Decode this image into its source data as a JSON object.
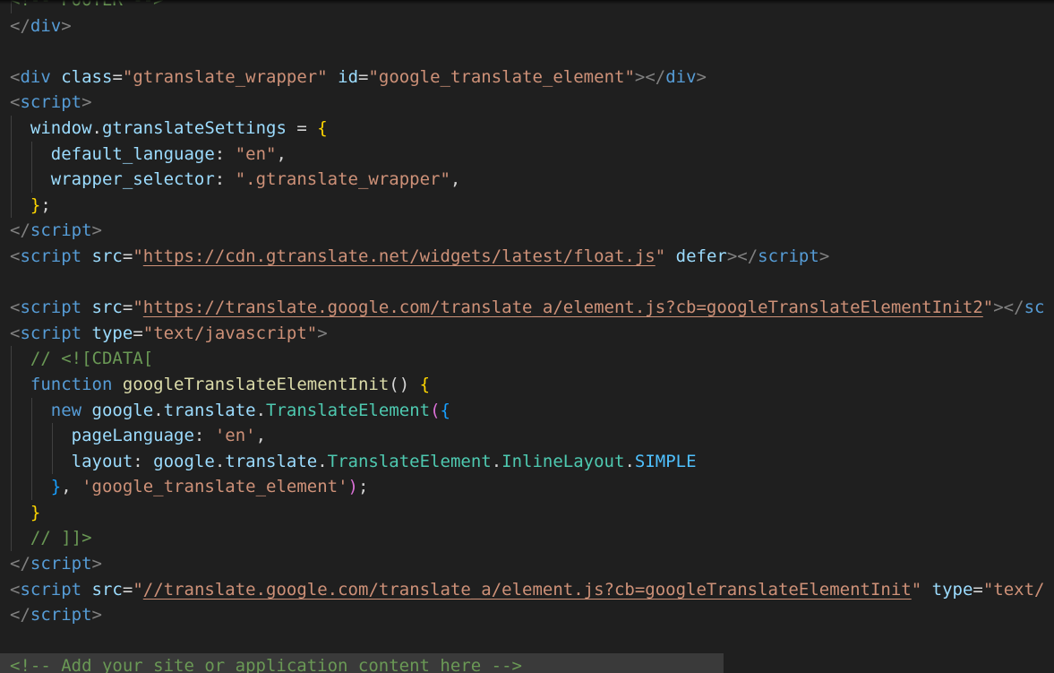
{
  "colors": {
    "background": "#1f1f1f",
    "tag": "#569cd6",
    "attribute": "#9cdcfe",
    "string": "#ce9178",
    "punctuation": "#808080",
    "function": "#dcdcaa",
    "class": "#4ec9b0",
    "comment": "#6a9955",
    "bracket_yellow": "#ffd700",
    "bracket_pink": "#da70d6",
    "bracket_blue": "#179fff"
  },
  "lines": [
    {
      "guides": 1,
      "highlight": false,
      "tokens": [
        {
          "t": "<!-- FOOTER -->",
          "c": "comment"
        }
      ]
    },
    {
      "guides": 0,
      "highlight": false,
      "tokens": [
        {
          "t": "</",
          "c": "punc"
        },
        {
          "t": "div",
          "c": "tag"
        },
        {
          "t": ">",
          "c": "punc"
        }
      ]
    },
    {
      "guides": 0,
      "highlight": false,
      "tokens": []
    },
    {
      "guides": 0,
      "highlight": false,
      "tokens": [
        {
          "t": "<",
          "c": "punc"
        },
        {
          "t": "div",
          "c": "tag"
        },
        {
          "t": " ",
          "c": "plain"
        },
        {
          "t": "class",
          "c": "attr"
        },
        {
          "t": "=",
          "c": "plain"
        },
        {
          "t": "\"gtranslate_wrapper\"",
          "c": "str"
        },
        {
          "t": " ",
          "c": "plain"
        },
        {
          "t": "id",
          "c": "attr"
        },
        {
          "t": "=",
          "c": "plain"
        },
        {
          "t": "\"google_translate_element\"",
          "c": "str"
        },
        {
          "t": "></",
          "c": "punc"
        },
        {
          "t": "div",
          "c": "tag"
        },
        {
          "t": ">",
          "c": "punc"
        }
      ]
    },
    {
      "guides": 0,
      "highlight": false,
      "tokens": [
        {
          "t": "<",
          "c": "punc"
        },
        {
          "t": "script",
          "c": "tag"
        },
        {
          "t": ">",
          "c": "punc"
        }
      ]
    },
    {
      "guides": 1,
      "highlight": false,
      "tokens": [
        {
          "t": "  ",
          "c": "plain"
        },
        {
          "t": "window",
          "c": "var"
        },
        {
          "t": ".",
          "c": "plain"
        },
        {
          "t": "gtranslateSettings",
          "c": "var"
        },
        {
          "t": " = ",
          "c": "plain"
        },
        {
          "t": "{",
          "c": "brace1"
        }
      ]
    },
    {
      "guides": 2,
      "highlight": false,
      "tokens": [
        {
          "t": "    ",
          "c": "plain"
        },
        {
          "t": "default_language",
          "c": "var"
        },
        {
          "t": ": ",
          "c": "plain"
        },
        {
          "t": "\"en\"",
          "c": "str"
        },
        {
          "t": ",",
          "c": "plain"
        }
      ]
    },
    {
      "guides": 2,
      "highlight": false,
      "tokens": [
        {
          "t": "    ",
          "c": "plain"
        },
        {
          "t": "wrapper_selector",
          "c": "var"
        },
        {
          "t": ": ",
          "c": "plain"
        },
        {
          "t": "\".gtranslate_wrapper\"",
          "c": "str"
        },
        {
          "t": ",",
          "c": "plain"
        }
      ]
    },
    {
      "guides": 1,
      "highlight": false,
      "tokens": [
        {
          "t": "  ",
          "c": "plain"
        },
        {
          "t": "}",
          "c": "brace1"
        },
        {
          "t": ";",
          "c": "plain"
        }
      ]
    },
    {
      "guides": 0,
      "highlight": false,
      "tokens": [
        {
          "t": "</",
          "c": "punc"
        },
        {
          "t": "script",
          "c": "tag"
        },
        {
          "t": ">",
          "c": "punc"
        }
      ]
    },
    {
      "guides": 0,
      "highlight": false,
      "tokens": [
        {
          "t": "<",
          "c": "punc"
        },
        {
          "t": "script",
          "c": "tag"
        },
        {
          "t": " ",
          "c": "plain"
        },
        {
          "t": "src",
          "c": "attr"
        },
        {
          "t": "=",
          "c": "plain"
        },
        {
          "t": "\"",
          "c": "str"
        },
        {
          "t": "https://cdn.gtranslate.net/widgets/latest/float.js",
          "c": "url"
        },
        {
          "t": "\"",
          "c": "str"
        },
        {
          "t": " ",
          "c": "plain"
        },
        {
          "t": "defer",
          "c": "attr"
        },
        {
          "t": "></",
          "c": "punc"
        },
        {
          "t": "script",
          "c": "tag"
        },
        {
          "t": ">",
          "c": "punc"
        }
      ]
    },
    {
      "guides": 0,
      "highlight": false,
      "tokens": []
    },
    {
      "guides": 0,
      "highlight": false,
      "tokens": [
        {
          "t": "<",
          "c": "punc"
        },
        {
          "t": "script",
          "c": "tag"
        },
        {
          "t": " ",
          "c": "plain"
        },
        {
          "t": "src",
          "c": "attr"
        },
        {
          "t": "=",
          "c": "plain"
        },
        {
          "t": "\"",
          "c": "str"
        },
        {
          "t": "https://translate.google.com/translate_a/element.js?cb=googleTranslateElementInit2",
          "c": "url"
        },
        {
          "t": "\"",
          "c": "str"
        },
        {
          "t": "></",
          "c": "punc"
        },
        {
          "t": "sc",
          "c": "tag"
        }
      ]
    },
    {
      "guides": 0,
      "highlight": false,
      "tokens": [
        {
          "t": "<",
          "c": "punc"
        },
        {
          "t": "script",
          "c": "tag"
        },
        {
          "t": " ",
          "c": "plain"
        },
        {
          "t": "type",
          "c": "attr"
        },
        {
          "t": "=",
          "c": "plain"
        },
        {
          "t": "\"text/javascript\"",
          "c": "str"
        },
        {
          "t": ">",
          "c": "punc"
        }
      ]
    },
    {
      "guides": 1,
      "highlight": false,
      "tokens": [
        {
          "t": "  ",
          "c": "plain"
        },
        {
          "t": "// <![CDATA[",
          "c": "comment"
        }
      ]
    },
    {
      "guides": 1,
      "highlight": false,
      "tokens": [
        {
          "t": "  ",
          "c": "plain"
        },
        {
          "t": "function",
          "c": "kw"
        },
        {
          "t": " ",
          "c": "plain"
        },
        {
          "t": "googleTranslateElementInit",
          "c": "func"
        },
        {
          "t": "() ",
          "c": "plain"
        },
        {
          "t": "{",
          "c": "brace1"
        }
      ]
    },
    {
      "guides": 2,
      "highlight": false,
      "tokens": [
        {
          "t": "    ",
          "c": "plain"
        },
        {
          "t": "new",
          "c": "kw"
        },
        {
          "t": " ",
          "c": "plain"
        },
        {
          "t": "google",
          "c": "var"
        },
        {
          "t": ".",
          "c": "plain"
        },
        {
          "t": "translate",
          "c": "var"
        },
        {
          "t": ".",
          "c": "plain"
        },
        {
          "t": "TranslateElement",
          "c": "class"
        },
        {
          "t": "(",
          "c": "brace2"
        },
        {
          "t": "{",
          "c": "brace3"
        }
      ]
    },
    {
      "guides": 3,
      "highlight": false,
      "tokens": [
        {
          "t": "      ",
          "c": "plain"
        },
        {
          "t": "pageLanguage",
          "c": "var"
        },
        {
          "t": ": ",
          "c": "plain"
        },
        {
          "t": "'en'",
          "c": "str"
        },
        {
          "t": ",",
          "c": "plain"
        }
      ]
    },
    {
      "guides": 3,
      "highlight": false,
      "tokens": [
        {
          "t": "      ",
          "c": "plain"
        },
        {
          "t": "layout",
          "c": "var"
        },
        {
          "t": ": ",
          "c": "plain"
        },
        {
          "t": "google",
          "c": "var"
        },
        {
          "t": ".",
          "c": "plain"
        },
        {
          "t": "translate",
          "c": "var"
        },
        {
          "t": ".",
          "c": "plain"
        },
        {
          "t": "TranslateElement",
          "c": "class"
        },
        {
          "t": ".",
          "c": "plain"
        },
        {
          "t": "InlineLayout",
          "c": "class"
        },
        {
          "t": ".",
          "c": "plain"
        },
        {
          "t": "SIMPLE",
          "c": "const"
        }
      ]
    },
    {
      "guides": 2,
      "highlight": false,
      "tokens": [
        {
          "t": "    ",
          "c": "plain"
        },
        {
          "t": "}",
          "c": "brace3"
        },
        {
          "t": ", ",
          "c": "plain"
        },
        {
          "t": "'google_translate_element'",
          "c": "str"
        },
        {
          "t": ")",
          "c": "brace2"
        },
        {
          "t": ";",
          "c": "plain"
        }
      ]
    },
    {
      "guides": 1,
      "highlight": false,
      "tokens": [
        {
          "t": "  ",
          "c": "plain"
        },
        {
          "t": "}",
          "c": "brace1"
        }
      ]
    },
    {
      "guides": 1,
      "highlight": false,
      "tokens": [
        {
          "t": "  ",
          "c": "plain"
        },
        {
          "t": "// ]]>",
          "c": "comment"
        }
      ]
    },
    {
      "guides": 0,
      "highlight": false,
      "tokens": [
        {
          "t": "</",
          "c": "punc"
        },
        {
          "t": "script",
          "c": "tag"
        },
        {
          "t": ">",
          "c": "punc"
        }
      ]
    },
    {
      "guides": 0,
      "highlight": false,
      "tokens": [
        {
          "t": "<",
          "c": "punc"
        },
        {
          "t": "script",
          "c": "tag"
        },
        {
          "t": " ",
          "c": "plain"
        },
        {
          "t": "src",
          "c": "attr"
        },
        {
          "t": "=",
          "c": "plain"
        },
        {
          "t": "\"",
          "c": "str"
        },
        {
          "t": "//translate.google.com/translate_a/element.js?cb=googleTranslateElementInit",
          "c": "url"
        },
        {
          "t": "\"",
          "c": "str"
        },
        {
          "t": " ",
          "c": "plain"
        },
        {
          "t": "type",
          "c": "attr"
        },
        {
          "t": "=",
          "c": "plain"
        },
        {
          "t": "\"text/",
          "c": "str"
        }
      ]
    },
    {
      "guides": 0,
      "highlight": false,
      "tokens": [
        {
          "t": "</",
          "c": "punc"
        },
        {
          "t": "script",
          "c": "tag"
        },
        {
          "t": ">",
          "c": "punc"
        }
      ]
    },
    {
      "guides": 0,
      "highlight": false,
      "tokens": []
    },
    {
      "guides": 0,
      "highlight": true,
      "tokens": [
        {
          "t": "<!-- Add your site or application content here -->",
          "c": "comment"
        }
      ]
    }
  ]
}
